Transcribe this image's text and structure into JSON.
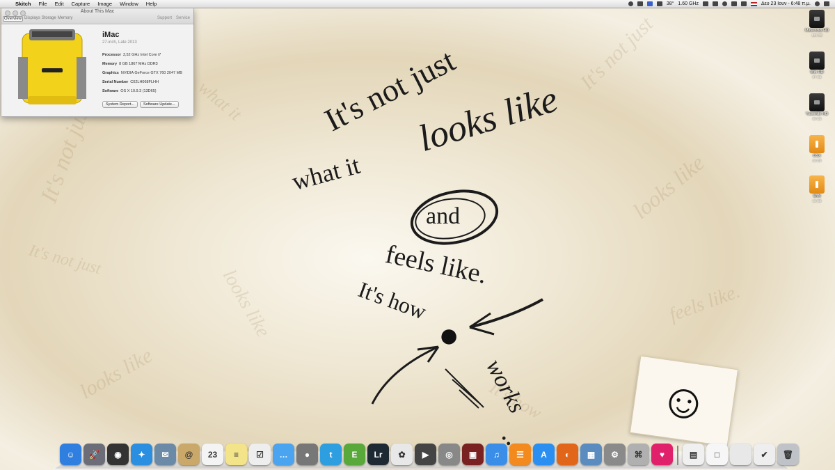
{
  "menubar": {
    "app_name": "Skitch",
    "items": [
      "File",
      "Edit",
      "Capture",
      "Image",
      "Window",
      "Help"
    ],
    "status": {
      "temperature": "38°",
      "cpu": "1.60 GHz",
      "date_time": "Δευ 23 Ιουν - 6:48 π.μ."
    }
  },
  "about_window": {
    "title": "About This Mac",
    "tabs": [
      "Overview",
      "Displays",
      "Storage",
      "Memory"
    ],
    "links": [
      "Support",
      "Service"
    ],
    "model_name": "iMac",
    "model_sub": "27-inch, Late 2013",
    "specs": [
      {
        "label": "Processor",
        "value": "3,52 GHz Intel Core i7"
      },
      {
        "label": "Memory",
        "value": "8 GB 1867 MHz DDR3"
      },
      {
        "label": "Graphics",
        "value": "NVIDIA GeForce GTX 760 2047 MB"
      },
      {
        "label": "Serial Number",
        "value": "C02LH068FLHH"
      },
      {
        "label": "Software",
        "value": "OS X 10.9.3 (13D65)"
      }
    ],
    "buttons": {
      "system_report": "System Report...",
      "software_update": "Software Update..."
    }
  },
  "quote": {
    "line1": "It's not just",
    "line2a": "what it",
    "line2b": "looks like",
    "and": "and",
    "feels": "feels like.",
    "hows": "It's how",
    "works": "works",
    "dots": "...."
  },
  "drives": [
    {
      "name": "Mavericks HD",
      "info": "120 GB"
    },
    {
      "name": "Win HD",
      "info": "97 GB"
    },
    {
      "name": "Yosemite HD",
      "info": "80 GB"
    },
    {
      "name": "OSX",
      "info": "16 GB"
    },
    {
      "name": "WIN",
      "info": "16 GB"
    }
  ],
  "dock": {
    "apps": [
      {
        "name": "finder",
        "glyph": "☺",
        "color": "#2f7fe0"
      },
      {
        "name": "launchpad",
        "glyph": "🚀",
        "color": "#6b6e78"
      },
      {
        "name": "dashboard",
        "glyph": "◉",
        "color": "#333333"
      },
      {
        "name": "safari",
        "glyph": "✦",
        "color": "#2a8fe0"
      },
      {
        "name": "preview",
        "glyph": "✉",
        "color": "#6a8aa8"
      },
      {
        "name": "contacts",
        "glyph": "@",
        "color": "#c9a86a"
      },
      {
        "name": "calendar",
        "glyph": "23",
        "color": "#f4f4f4"
      },
      {
        "name": "notes",
        "glyph": "≡",
        "color": "#f3e48a"
      },
      {
        "name": "reminders",
        "glyph": "☑",
        "color": "#eeeeee"
      },
      {
        "name": "messages",
        "glyph": "…",
        "color": "#4aa4f0"
      },
      {
        "name": "facetime",
        "glyph": "●",
        "color": "#777777"
      },
      {
        "name": "twitter",
        "glyph": "t",
        "color": "#2d9ee0"
      },
      {
        "name": "evernote",
        "glyph": "E",
        "color": "#59a83a"
      },
      {
        "name": "lightroom",
        "glyph": "Lr",
        "color": "#1e2a33"
      },
      {
        "name": "photos",
        "glyph": "✿",
        "color": "#e8e8e8"
      },
      {
        "name": "final-cut",
        "glyph": "▶",
        "color": "#444444"
      },
      {
        "name": "aperture",
        "glyph": "◎",
        "color": "#888888"
      },
      {
        "name": "photo-booth",
        "glyph": "▣",
        "color": "#7a2222"
      },
      {
        "name": "itunes",
        "glyph": "♫",
        "color": "#3a8ee8"
      },
      {
        "name": "ibooks",
        "glyph": "☰",
        "color": "#f28a1e"
      },
      {
        "name": "app-store",
        "glyph": "A",
        "color": "#2a8ff0"
      },
      {
        "name": "firefox",
        "glyph": "◐",
        "color": "#e2661a"
      },
      {
        "name": "archive-utility",
        "glyph": "▦",
        "color": "#5a8cc0"
      },
      {
        "name": "system-preferences",
        "glyph": "⚙",
        "color": "#8a8a8a"
      },
      {
        "name": "network-utility",
        "glyph": "⌘",
        "color": "#b0b0b0"
      },
      {
        "name": "heart-app",
        "glyph": "♥",
        "color": "#e0206a"
      }
    ],
    "right_items": [
      {
        "name": "stack-documents",
        "glyph": "▤",
        "color": "#f0f0f0"
      },
      {
        "name": "stack-applications",
        "glyph": "□",
        "color": "#f6f6f6"
      },
      {
        "name": "stack-apple",
        "glyph": "",
        "color": "#e8e8e8"
      },
      {
        "name": "stack-downloads",
        "glyph": "✔",
        "color": "#eeeeee"
      },
      {
        "name": "trash",
        "glyph": "🗑",
        "color": "#bfc3c8"
      }
    ]
  },
  "sticker": {
    "glyph": "☺"
  }
}
